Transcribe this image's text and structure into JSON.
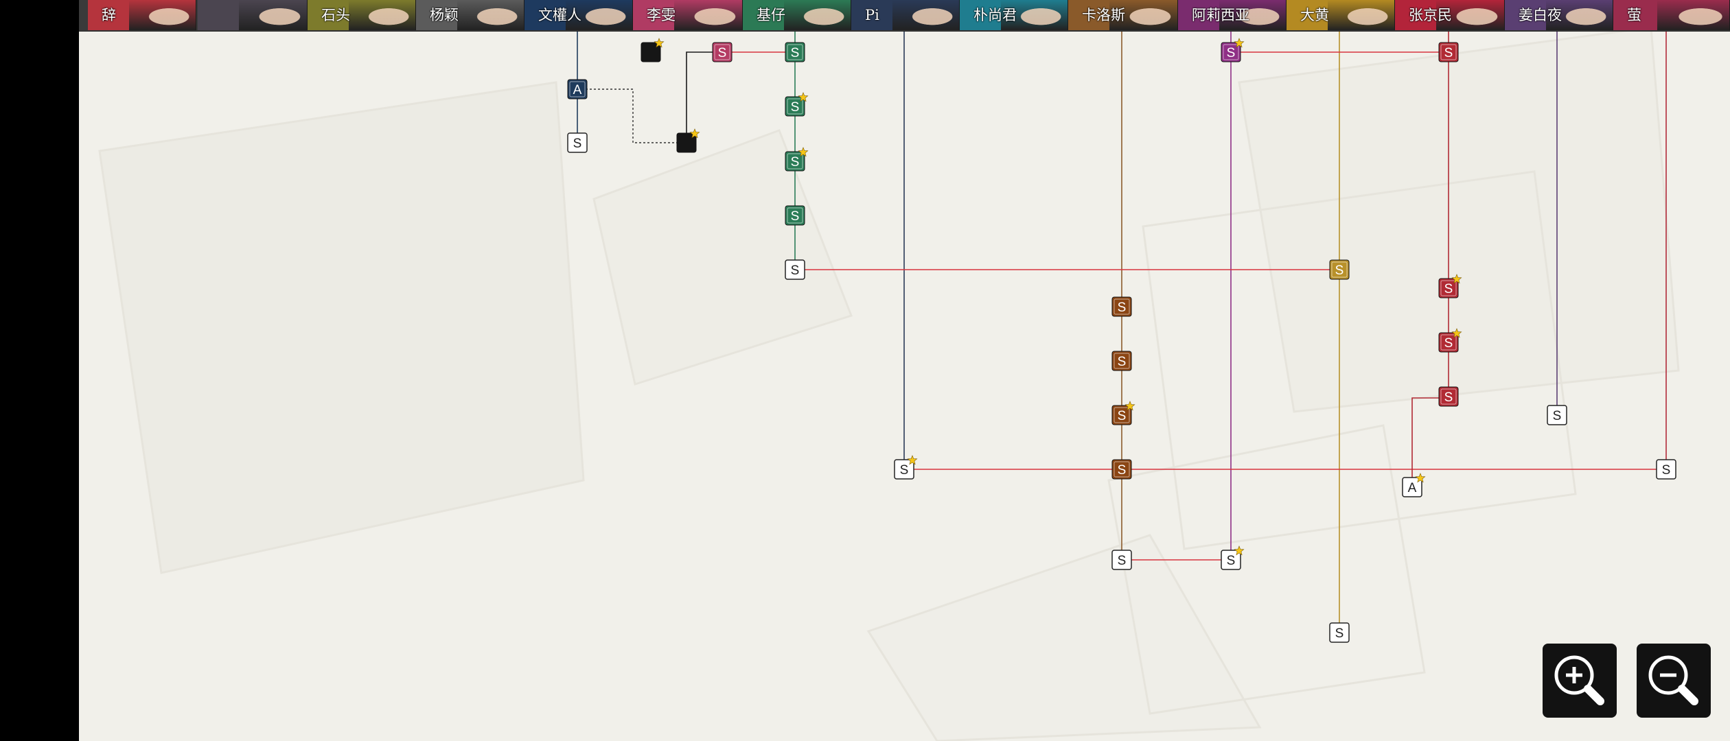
{
  "tabs": [
    {
      "name": "辞",
      "color": "#b5343d"
    },
    {
      "name": "",
      "color": "#4b4550"
    },
    {
      "name": "石头",
      "color": "#7d7b2c"
    },
    {
      "name": "杨颖",
      "color": "#5b5b5b"
    },
    {
      "name": "文權人",
      "color": "#1e3a5f"
    },
    {
      "name": "李雯",
      "color": "#b03b63"
    },
    {
      "name": "基仔",
      "color": "#2c7a55"
    },
    {
      "name": "Pi",
      "color": "#2a3a57"
    },
    {
      "name": "朴尚君",
      "color": "#1f7d8f"
    },
    {
      "name": "卡洛斯",
      "color": "#8a5a2a"
    },
    {
      "name": "阿莉西亚",
      "color": "#7a2c6e"
    },
    {
      "name": "大黄",
      "color": "#b48a22"
    },
    {
      "name": "张京民",
      "color": "#b3243a"
    },
    {
      "name": "姜白夜",
      "color": "#5a3f72"
    },
    {
      "name": "萤",
      "color": "#9a2c4d"
    }
  ],
  "node_colors": {
    "navy": "#1f3b5c",
    "black": "#161616",
    "pink": "#b43b63",
    "green": "#2b7c57",
    "purple": "#8f2f86",
    "red": "#b12a34",
    "brown": "#8b4513",
    "gold": "#b8912a",
    "white": "#ffffff",
    "star": "#f5c518"
  },
  "nodes": [
    {
      "id": "n1",
      "col": "文權人",
      "label": "A",
      "color": "navy",
      "star": false
    },
    {
      "id": "n2",
      "col": "文權人",
      "label": "S",
      "color": "white",
      "star": false
    },
    {
      "id": "n3",
      "col": "李雯",
      "label": "",
      "color": "black",
      "star": true
    },
    {
      "id": "n4",
      "col": "李雯",
      "label": "",
      "color": "black",
      "star": true
    },
    {
      "id": "n5",
      "col": "李雯",
      "label": "S",
      "color": "pink",
      "star": false
    },
    {
      "id": "n6",
      "col": "基仔",
      "label": "S",
      "color": "green",
      "star": false
    },
    {
      "id": "n7",
      "col": "基仔",
      "label": "S",
      "color": "green",
      "star": true
    },
    {
      "id": "n8",
      "col": "基仔",
      "label": "S",
      "color": "green",
      "star": true
    },
    {
      "id": "n9",
      "col": "基仔",
      "label": "S",
      "color": "green",
      "star": false
    },
    {
      "id": "n10",
      "col": "基仔",
      "label": "S",
      "color": "white",
      "star": false
    },
    {
      "id": "n11",
      "col": "Pi",
      "label": "S",
      "color": "white",
      "star": true
    },
    {
      "id": "n12",
      "col": "卡洛斯",
      "label": "S",
      "color": "brown",
      "star": false
    },
    {
      "id": "n13",
      "col": "卡洛斯",
      "label": "S",
      "color": "brown",
      "star": false
    },
    {
      "id": "n14",
      "col": "卡洛斯",
      "label": "S",
      "color": "brown",
      "star": true
    },
    {
      "id": "n15",
      "col": "卡洛斯",
      "label": "S",
      "color": "brown",
      "star": false
    },
    {
      "id": "n16",
      "col": "卡洛斯",
      "label": "S",
      "color": "white",
      "star": false
    },
    {
      "id": "n17",
      "col": "阿莉西亚",
      "label": "S",
      "color": "purple",
      "star": true
    },
    {
      "id": "n18",
      "col": "阿莉西亚",
      "label": "S",
      "color": "white",
      "star": true
    },
    {
      "id": "n19",
      "col": "大黄",
      "label": "S",
      "color": "gold",
      "star": false
    },
    {
      "id": "n20",
      "col": "大黄",
      "label": "S",
      "color": "white",
      "star": false
    },
    {
      "id": "n21",
      "col": "张京民",
      "label": "S",
      "color": "red",
      "star": false
    },
    {
      "id": "n22",
      "col": "张京民",
      "label": "S",
      "color": "red",
      "star": true
    },
    {
      "id": "n23",
      "col": "张京民",
      "label": "S",
      "color": "red",
      "star": true
    },
    {
      "id": "n24",
      "col": "张京民",
      "label": "S",
      "color": "red",
      "star": false
    },
    {
      "id": "n25",
      "col": "张京民",
      "label": "A",
      "color": "white",
      "star": true
    },
    {
      "id": "n26",
      "col": "姜白夜",
      "label": "S",
      "color": "white",
      "star": false
    },
    {
      "id": "n27",
      "col": "萤",
      "label": "S",
      "color": "white",
      "star": false
    }
  ],
  "controls": {
    "zoom_in": {
      "icon": "zoom-in-icon"
    },
    "zoom_out": {
      "icon": "zoom-out-icon"
    }
  }
}
